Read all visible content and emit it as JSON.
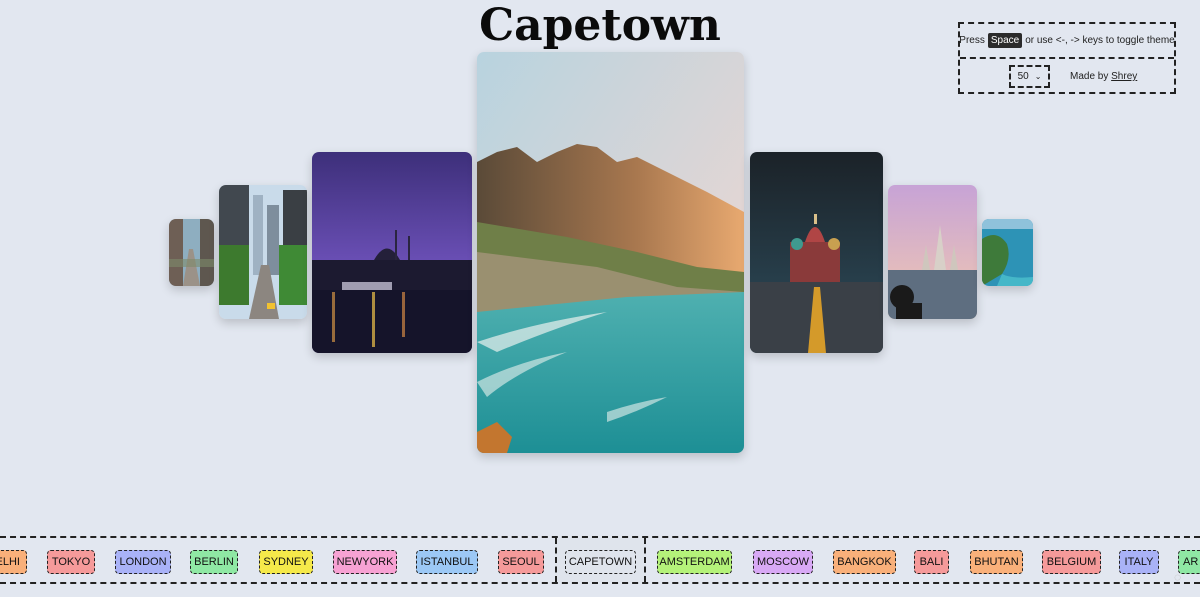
{
  "header": {
    "title": "Capetown"
  },
  "info": {
    "press": "Press",
    "key": "Space",
    "rest": "or use <-, -> keys to toggle theme",
    "speed_value": "50",
    "made_by_prefix": "Made by",
    "made_by_name": "Shrey"
  },
  "cities": [
    {
      "label": "ELHI",
      "color": "#f9b07a"
    },
    {
      "label": "TOKYO",
      "color": "#f59a9a"
    },
    {
      "label": "LONDON",
      "color": "#a9b2f7"
    },
    {
      "label": "BERLIN",
      "color": "#8fe8a4"
    },
    {
      "label": "SYDNEY",
      "color": "#f5e94a"
    },
    {
      "label": "NEWYORK",
      "color": "#f7a2d3"
    },
    {
      "label": "ISTANBUL",
      "color": "#9cc8f5"
    },
    {
      "label": "SEOUL",
      "color": "#f59a9a"
    },
    {
      "label": "CAPETOWN",
      "color": "#dfe4ec"
    },
    {
      "label": "AMSTERDAM",
      "color": "#b4f27a"
    },
    {
      "label": "MOSCOW",
      "color": "#d8a9f5"
    },
    {
      "label": "BANGKOK",
      "color": "#f9b07a"
    },
    {
      "label": "BALI",
      "color": "#f59a9a"
    },
    {
      "label": "BHUTAN",
      "color": "#f9b07a"
    },
    {
      "label": "BELGIUM",
      "color": "#f59a9a"
    },
    {
      "label": "ITALY",
      "color": "#a9b2f7"
    },
    {
      "label": "AR",
      "color": "#8fe8a4"
    }
  ]
}
